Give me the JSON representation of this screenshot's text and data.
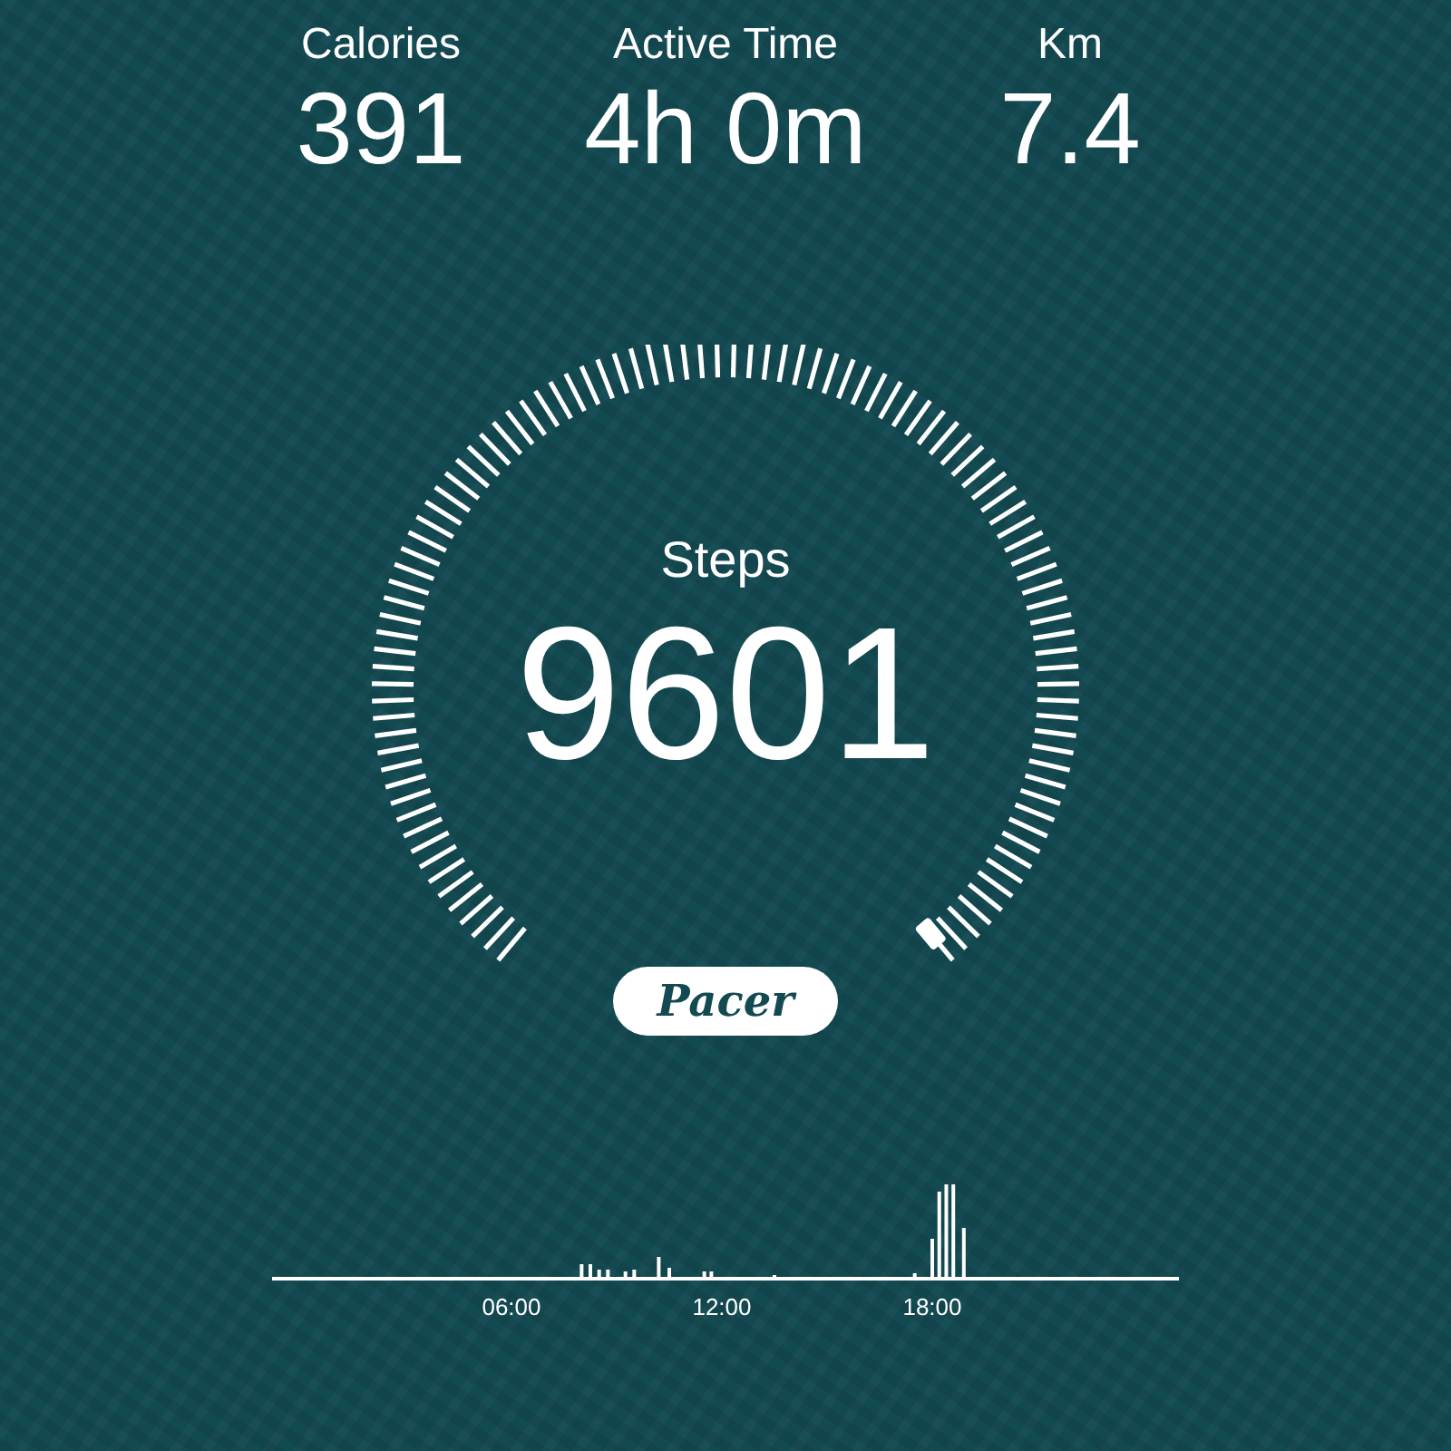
{
  "stats": [
    {
      "label": "Calories",
      "value": "391"
    },
    {
      "label": "Active Time",
      "value": "4h 0m"
    },
    {
      "label": "Km",
      "value": "7.4"
    }
  ],
  "steps": {
    "label": "Steps",
    "value": "9601"
  },
  "logo": "Pacer",
  "activity": {
    "time_labels": [
      "06:00",
      "12:00",
      "18:00"
    ]
  }
}
